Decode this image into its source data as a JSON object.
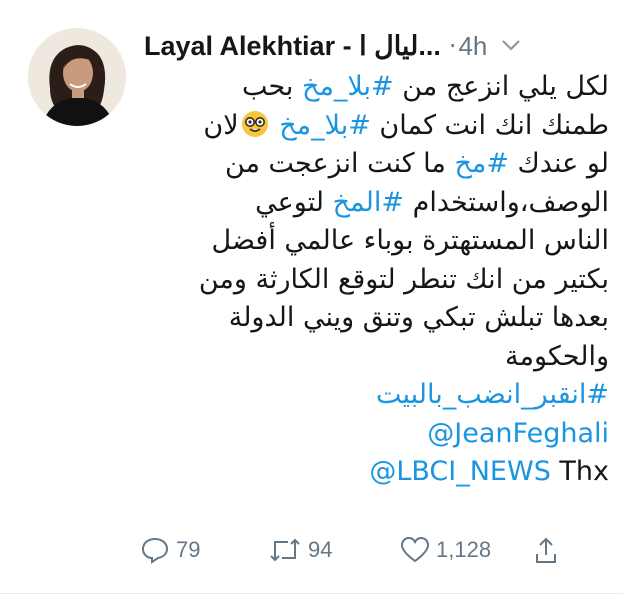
{
  "tweet": {
    "author_name": "Layal Alekhtiar - ليال ا...",
    "separator": "·",
    "time": "4h",
    "lines": [
      [
        "لكل يلي انزعج من ",
        {
          "tag": "#بلا_مخ"
        },
        " بحب"
      ],
      [
        "طمنك انك انت كمان ",
        {
          "tag": "#بلا_مخ"
        },
        " ",
        {
          "emoji": "nerd-face"
        },
        "لان"
      ],
      [
        "لو عندك ",
        {
          "tag": "#مخ"
        },
        " ما كنت انزعجت من"
      ],
      [
        "الوصف،واستخدام ",
        {
          "tag": "#المخ"
        },
        " لتوعي"
      ],
      [
        "الناس المستهترة بوباء عالمي أفضل"
      ],
      [
        "بكتير من انك تنطر لتوقع الكارثة ومن"
      ],
      [
        "بعدها تبلش تبكي وتنق ويني الدولة"
      ],
      [
        "والحكومة"
      ],
      [
        {
          "tag": "#انقبر_انضب_بالبيت"
        }
      ],
      [
        {
          "tag": "@JeanFeghali",
          "ltr": true
        }
      ],
      [
        {
          "tag": "@LBCI_NEWS",
          "ltr": true
        },
        {
          "text_ltr": " Thx"
        }
      ]
    ]
  },
  "actions": {
    "reply_count": "79",
    "retweet_count": "94",
    "like_count": "1,128"
  },
  "colors": {
    "link": "#1b95e0",
    "muted": "#657786",
    "text": "#14171a"
  }
}
